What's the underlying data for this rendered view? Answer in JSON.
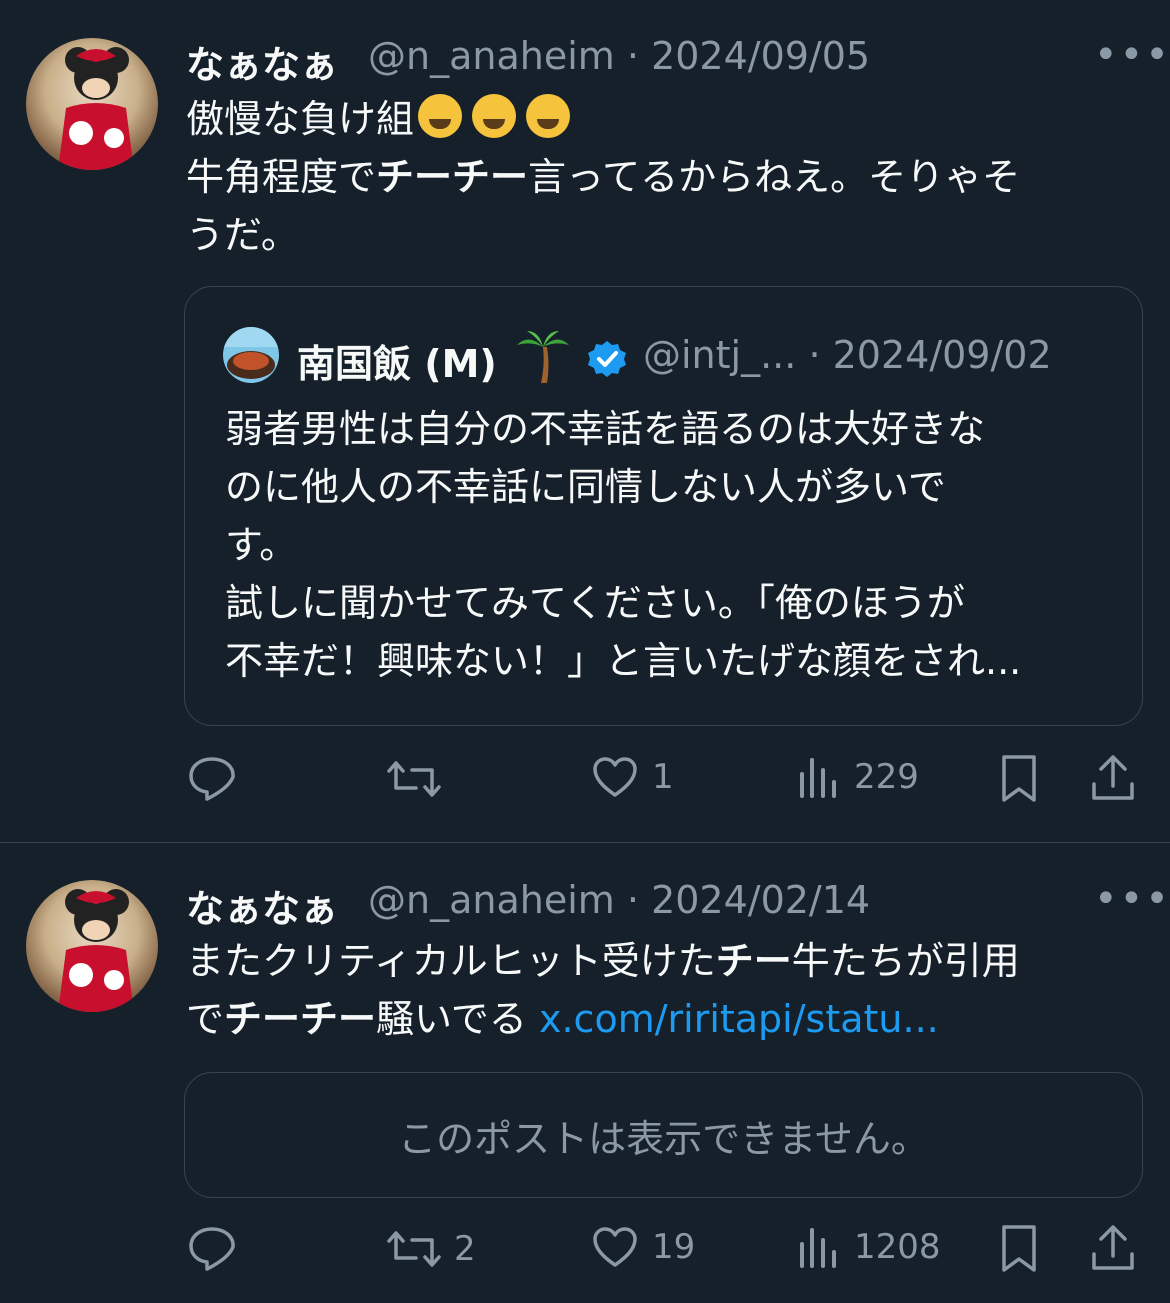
{
  "post1": {
    "display_name": "なぁなぁ",
    "handle": "@n_anaheim",
    "sep": "·",
    "date": "2024/09/05",
    "more_icon": "ellipsis-icon",
    "line1": "傲慢な負け組",
    "line2_a": "牛角程度で",
    "line2_b": "チーチー",
    "line2_c": "言ってるからねえ。そりゃそ",
    "line3": "うだ。",
    "quote": {
      "display_name": "南国飯 (M)",
      "palm_icon": "palm-tree-emoji",
      "verified_icon": "verified-badge-icon",
      "handle": "@intj_...",
      "sep": "·",
      "date": "2024/09/02",
      "lines": [
        "弱者男性は自分の不幸話を語るのは大好きな",
        "のに他人の不幸話に同情しない人が多いで",
        "す。",
        "試しに聞かせてみてください。「俺のほうが",
        "不幸だ！興味ない！」と言いたげな顔をされ..."
      ]
    },
    "actions": {
      "reply_count": "",
      "repost_count": "",
      "like_count": "1",
      "views_count": "229"
    }
  },
  "post2": {
    "display_name": "なぁなぁ",
    "handle": "@n_anaheim",
    "sep": "·",
    "date": "2024/02/14",
    "line1_a": "またクリティカルヒット受けた",
    "line1_b": "チー",
    "line1_c": "牛たちが引用",
    "line2_a": "で",
    "line2_b": "チーチー",
    "line2_c": "騒いでる ",
    "link": "x.com/riritapi/statu...",
    "unavailable": "このポストは表示できません。",
    "actions": {
      "reply_count": "",
      "repost_count": "2",
      "like_count": "19",
      "views_count": "1208"
    }
  },
  "colors": {
    "background": "#15202b",
    "text": "#f7f9f9",
    "secondary": "#8b98a5",
    "link": "#1d9bf0",
    "border": "#38444d",
    "verified": "#1d9bf0"
  }
}
